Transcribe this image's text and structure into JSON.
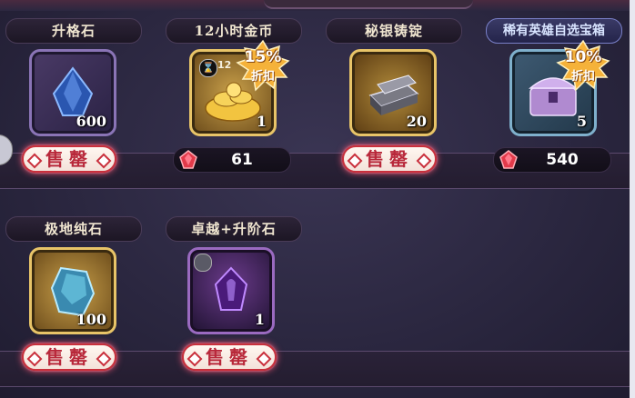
{
  "shop": {
    "sell_label": "售罄",
    "items": [
      {
        "title": "升格石",
        "count": "600",
        "state": "sold_out",
        "icon": "ascension-stone-icon"
      },
      {
        "title": "12小时金币",
        "count": "1",
        "state": "price",
        "price": "61",
        "discount_pct": "15%",
        "discount_label": "折扣",
        "timer_text": "12",
        "icon": "gold-coin-pile-icon"
      },
      {
        "title": "秘银铸锭",
        "count": "20",
        "state": "sold_out",
        "icon": "mithril-ingot-icon"
      },
      {
        "title": "稀有英雄自选宝箱",
        "count": "5",
        "state": "price",
        "price": "540",
        "discount_pct": "10%",
        "discount_label": "折扣",
        "icon": "hero-chest-icon"
      },
      {
        "title": "极地纯石",
        "count": "100",
        "state": "sold_out",
        "icon": "polar-stone-icon"
      },
      {
        "title": "卓越+升阶石",
        "count": "1",
        "state": "sold_out",
        "icon": "excellence-stone-icon"
      }
    ]
  },
  "colors": {
    "accent_red": "#c9303c",
    "gem_red": "#e23a4a",
    "gold": "#e8c468"
  }
}
